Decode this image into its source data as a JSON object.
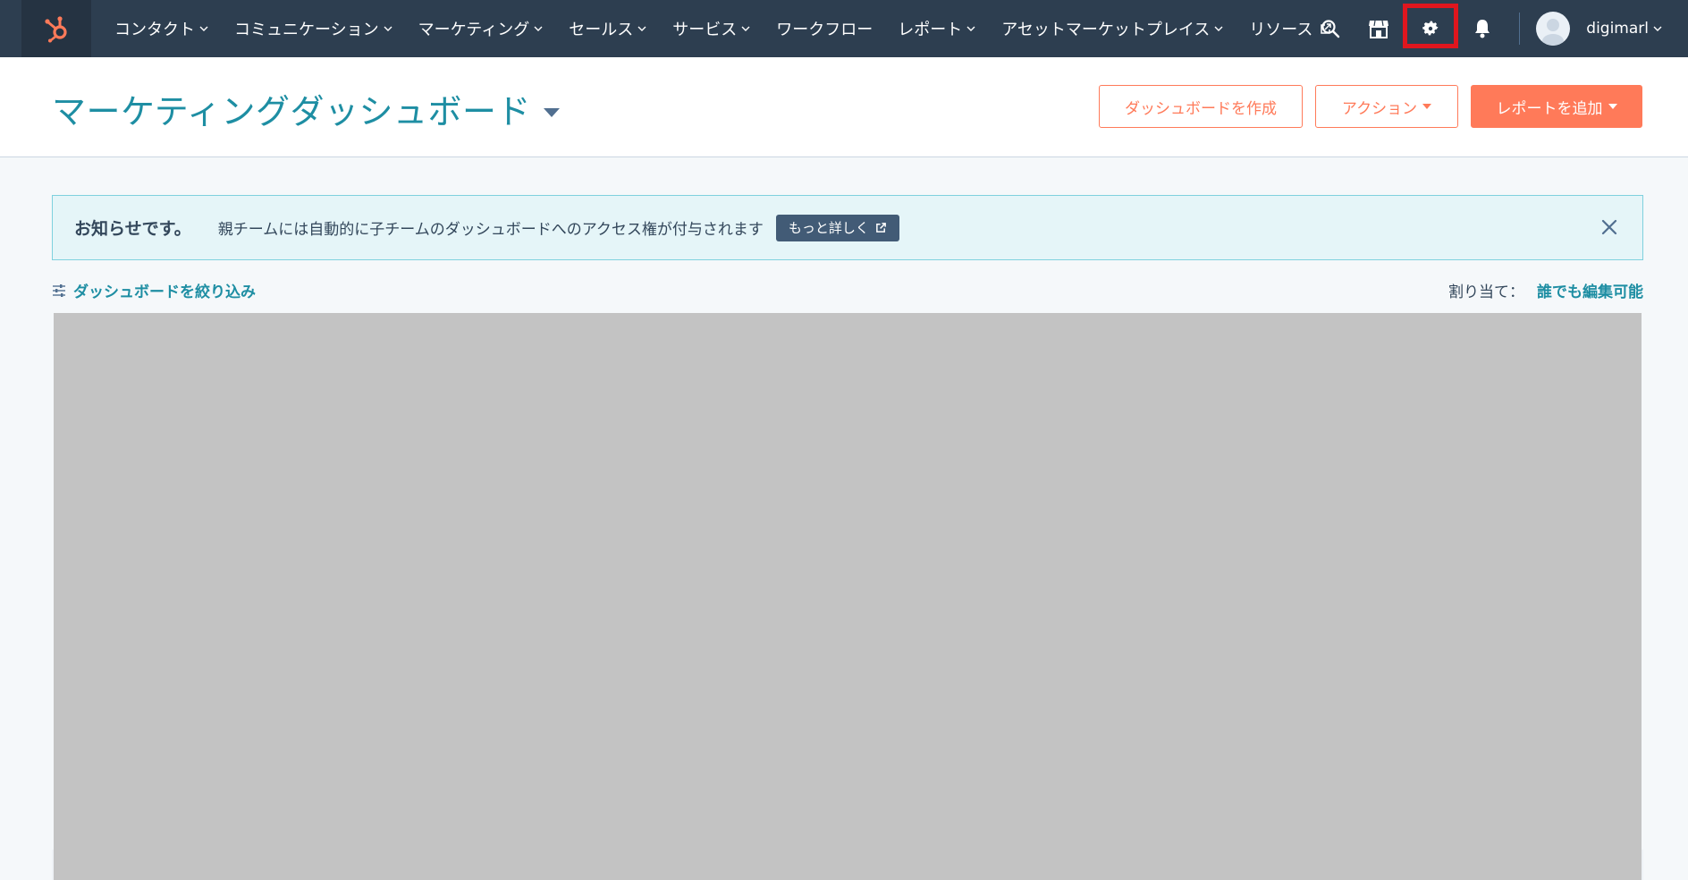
{
  "nav": {
    "items": [
      {
        "label": "コンタクト",
        "dropdown": true
      },
      {
        "label": "コミュニケーション",
        "dropdown": true
      },
      {
        "label": "マーケティング",
        "dropdown": true
      },
      {
        "label": "セールス",
        "dropdown": true
      },
      {
        "label": "サービス",
        "dropdown": true
      },
      {
        "label": "ワークフロー",
        "dropdown": false
      },
      {
        "label": "レポート",
        "dropdown": true
      },
      {
        "label": "アセットマーケットプレイス",
        "dropdown": true
      },
      {
        "label": "リソース",
        "external": true
      }
    ],
    "account_name": "digimarl",
    "icons": [
      "search-icon",
      "marketplace-icon",
      "settings-icon",
      "notifications-icon"
    ]
  },
  "header": {
    "title": "マーケティングダッシュボード",
    "create_dashboard": "ダッシュボードを作成",
    "actions": "アクション",
    "add_report": "レポートを追加"
  },
  "alert": {
    "title": "お知らせです。",
    "body": "親チームには自動的に子チームのダッシュボードへのアクセス権が付与されます",
    "link": "もっと詳しく"
  },
  "filter": {
    "label": "ダッシュボードを絞り込み",
    "assign_label": "割り当て：",
    "assign_value": "誰でも編集可能"
  },
  "colors": {
    "nav_bg": "#2d3e50",
    "accent": "#ff7a59",
    "link": "#1e8ea3",
    "highlight": "#e0161e"
  }
}
